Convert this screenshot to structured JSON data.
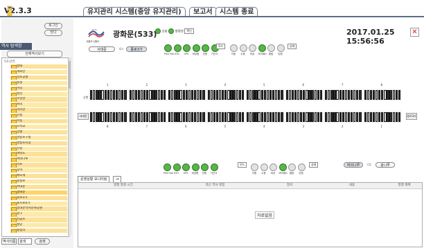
{
  "app": {
    "version": "V2.3.3",
    "tabs": [
      {
        "label": "유지관리 시스템(중앙 유지관리)"
      },
      {
        "label": "보고서"
      },
      {
        "label": "시스템 종료"
      }
    ]
  },
  "left_panel": {
    "login_label": "로그인",
    "logout_label": "닫다",
    "title": "역사 탐색창",
    "refresh_label": "전체역사보기",
    "tree_root": "5호선역",
    "stations": [
      "방화",
      "개화산",
      "김포공항",
      "송정",
      "마곡",
      "발산",
      "우장산",
      "화곡",
      "까치산",
      "신정",
      "목동",
      "오목교",
      "양평",
      "영등포구청",
      "영등포시장",
      "신길",
      "여의도",
      "여의나루",
      "마포",
      "공덕",
      "애오개",
      "충정로",
      "서대문",
      "광화문",
      "종로3가",
      "을지로4가",
      "동대문역사문화공원",
      "청구",
      "신금호",
      "행당",
      "왕십리"
    ],
    "selected_station": "광화문",
    "search_select": "역사이름",
    "search_value": "검색",
    "search_button": "검색"
  },
  "header": {
    "station": "광화문(533)",
    "datetime": "2017.01.25 15:56:56",
    "radio_a": "선로",
    "radio_b": "정류장",
    "confirm_label": "확인",
    "logo_caption": "서울도시철도"
  },
  "upper": {
    "nav_left": "서대문",
    "nav_right": "종로3가",
    "indicators": [
      "PSD Fail",
      "ATO",
      "UPS",
      "비상함",
      "전동",
      "기관사"
    ],
    "mode_label": "모드",
    "mode_items": [
      "자동",
      "수동",
      "비상",
      "바이패스",
      "열림",
      "닫힘"
    ],
    "status_label": "상태"
  },
  "lower": {
    "nav_left": "여의나루",
    "nav_right": "광나루",
    "indicators": [
      "PSD Fail",
      "ATO",
      "UPS",
      "비상함",
      "전동",
      "기관사"
    ],
    "mode_label": "모드",
    "mode_items": [
      "자동",
      "수동",
      "비상",
      "바이패스",
      "열림",
      "닫힘"
    ],
    "status_label": "상태"
  },
  "platform": {
    "up_label": "상행",
    "down_label": "하행",
    "left_tag": "서대문",
    "right_tag": "종로3가",
    "upper_car_numbers": [
      "1",
      "2",
      "3",
      "4",
      "5",
      "6",
      "7",
      "8"
    ],
    "lower_car_numbers": [
      "8",
      "7",
      "6",
      "5",
      "4",
      "3",
      "2",
      "1"
    ],
    "door_state_upper": "closed",
    "door_state_lower": "closed"
  },
  "log": {
    "title": "운영상황 모니터링",
    "columns": [
      "발행 발생 시간",
      "최근 역사 명칭",
      "장비",
      "내용",
      "발행 해제"
    ],
    "empty": "자료없음"
  },
  "colors": {
    "accent": "#4a5a70",
    "indicator_on": "#59b548",
    "selected_row": "#f5c242",
    "alert": "#d91c1c"
  }
}
